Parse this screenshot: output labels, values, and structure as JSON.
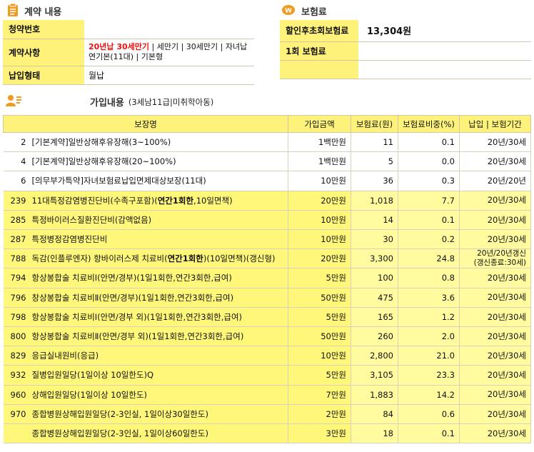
{
  "contract": {
    "title": "계약 내용",
    "rows": [
      {
        "label": "청약번호",
        "value": ""
      },
      {
        "label": "계약사항",
        "value_highlight": "20년납 30세만기",
        "value_rest": " | 세만기 | 30세만기 | 자녀납연기본(11대) | 기본형"
      },
      {
        "label": "납입형태",
        "value": "월납"
      }
    ]
  },
  "premium": {
    "title": "보험료",
    "rows": [
      {
        "label": "할인후초회보험료",
        "value": "13,304원"
      },
      {
        "label": "1회 보험료",
        "value": ""
      }
    ]
  },
  "coverage": {
    "title": "가입내용",
    "subtitle": "(3세남11급|미취학아동)",
    "headers": [
      "보장명",
      "가입금액",
      "보험료(원)",
      "보험료비중(%)",
      "납입 | 보험기간"
    ],
    "rows": [
      {
        "code": "2",
        "name": "[기본계약]일반상해후유장해(3~100%)",
        "amount": "1백만원",
        "premium": "11",
        "ratio": "0.1",
        "period": "20년/30세",
        "hl": false
      },
      {
        "code": "4",
        "name": "[기본계약]일반상해후유장해(20~100%)",
        "amount": "1백만원",
        "premium": "5",
        "ratio": "0.0",
        "period": "20년/30세",
        "hl": false
      },
      {
        "code": "6",
        "name": "[의무부가특약]자녀보험료납입면제대상보장(11대)",
        "amount": "10만원",
        "premium": "36",
        "ratio": "0.3",
        "period": "20년/20년",
        "hl": false
      },
      {
        "code": "239",
        "name": "11대특정감염병진단비(수족구포함)(연간1회한,10일면책)",
        "amount": "20만원",
        "premium": "1,018",
        "ratio": "7.7",
        "period": "20년/30세",
        "hl": true
      },
      {
        "code": "285",
        "name": "특정바이러스질환진단비(감액없음)",
        "amount": "10만원",
        "premium": "14",
        "ratio": "0.1",
        "period": "20년/30세",
        "hl": true
      },
      {
        "code": "287",
        "name": "특정병정감염병진단비",
        "amount": "10만원",
        "premium": "30",
        "ratio": "0.2",
        "period": "20년/30세",
        "hl": true
      },
      {
        "code": "788",
        "name": "독감(인플루엔자) 항바이러스제 치료비(연간1회한)(10일면책)(갱신형)",
        "amount": "20만원",
        "premium": "3,300",
        "ratio": "24.8",
        "period": "20년/20년갱신 (갱신종료:30세)",
        "hl": true
      },
      {
        "code": "794",
        "name": "항상봉합술 치료비Ⅰ(안면/경부)(1일1회한,연간3회한,급여)",
        "amount": "5만원",
        "premium": "100",
        "ratio": "0.8",
        "period": "20년/30세",
        "hl": true
      },
      {
        "code": "796",
        "name": "창상봉합술 치료비Ⅱ(안면/경부)(1일1회한,연간3회한,급여)",
        "amount": "50만원",
        "premium": "475",
        "ratio": "3.6",
        "period": "20년/30세",
        "hl": true
      },
      {
        "code": "798",
        "name": "항상봉합술 치료비Ⅰ(안면/경부 외)(1일1회한,연간3회한,급여)",
        "amount": "5만원",
        "premium": "165",
        "ratio": "1.2",
        "period": "20년/30세",
        "hl": true
      },
      {
        "code": "800",
        "name": "항상봉합술 치료비Ⅱ(안면/경부 외)(1일1회한,연간3회한,급여)",
        "amount": "50만원",
        "premium": "260",
        "ratio": "2.0",
        "period": "20년/30세",
        "hl": true
      },
      {
        "code": "829",
        "name": "응급실내원비(응급)",
        "amount": "10만원",
        "premium": "2,800",
        "ratio": "21.0",
        "period": "20년/30세",
        "hl": true
      },
      {
        "code": "932",
        "name": "질병입원일당(1일이상 10일한도)Q",
        "amount": "5만원",
        "premium": "3,105",
        "ratio": "23.3",
        "period": "20년/30세",
        "hl": true
      },
      {
        "code": "960",
        "name": "상해입원일당(1일이상 10일한도)",
        "amount": "7만원",
        "premium": "1,883",
        "ratio": "14.2",
        "period": "20년/30세",
        "hl": true
      },
      {
        "code": "970",
        "name": "종합병원상해입원일당(2-3인실, 1일이상30일한도)",
        "amount": "2만원",
        "premium": "84",
        "ratio": "0.6",
        "period": "20년/30세",
        "hl": true
      },
      {
        "code": "",
        "name": "종합병원상해입원일당(2-3인실, 1일이상60일한도)",
        "amount": "3만원",
        "premium": "18",
        "ratio": "0.1",
        "period": "20년/30세",
        "hl": true
      }
    ]
  },
  "colors": {
    "header_yellow": "#fff27a",
    "highlight_yellow": "#fffb9e",
    "accent_orange": "#f29a1d",
    "red": "#e11111"
  }
}
